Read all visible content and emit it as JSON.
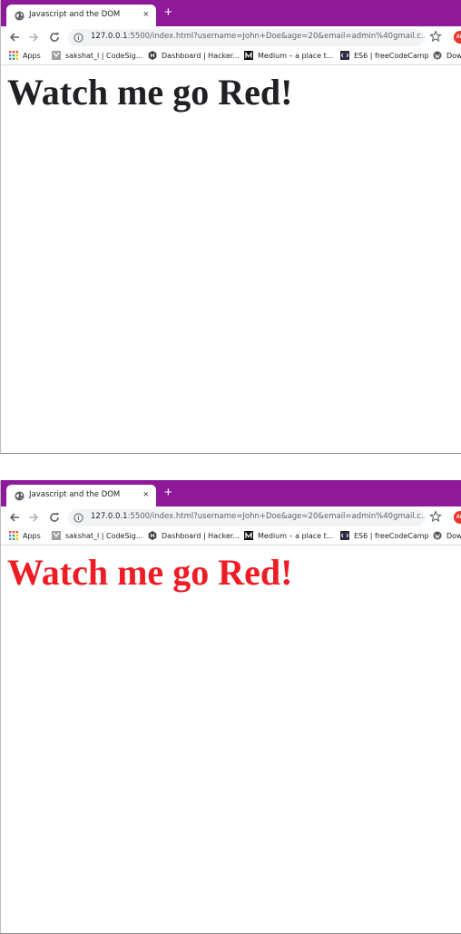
{
  "browser": {
    "tab_title": "Javascript and the DOM",
    "tab_close": "×",
    "new_tab": "+",
    "url_host": "127.0.0.1",
    "url_rest": ":5500/index.html?username=John+Doe&age=20&email=admin%40gmail.c...",
    "extension_label": "AB",
    "bookmarks": [
      {
        "label": "Apps",
        "icon": "apps-grid-icon"
      },
      {
        "label": "sakshat_l | CodeSig...",
        "icon": "codesignal-icon"
      },
      {
        "label": "Dashboard | Hacker...",
        "icon": "hackerrank-icon"
      },
      {
        "label": "Medium – a place t...",
        "icon": "medium-icon"
      },
      {
        "label": "ES6 | freeCodeCamp",
        "icon": "freecodecamp-icon"
      },
      {
        "label": "Dow",
        "icon": "wordpress-icon"
      }
    ]
  },
  "before": {
    "heading": "Watch me go Red!",
    "heading_color": "#202124"
  },
  "after": {
    "heading": "Watch me go Red!",
    "heading_color": "#ee1c24"
  },
  "colors": {
    "tabstrip": "#8e1a9a",
    "omnibox": "#f1f3f4"
  }
}
